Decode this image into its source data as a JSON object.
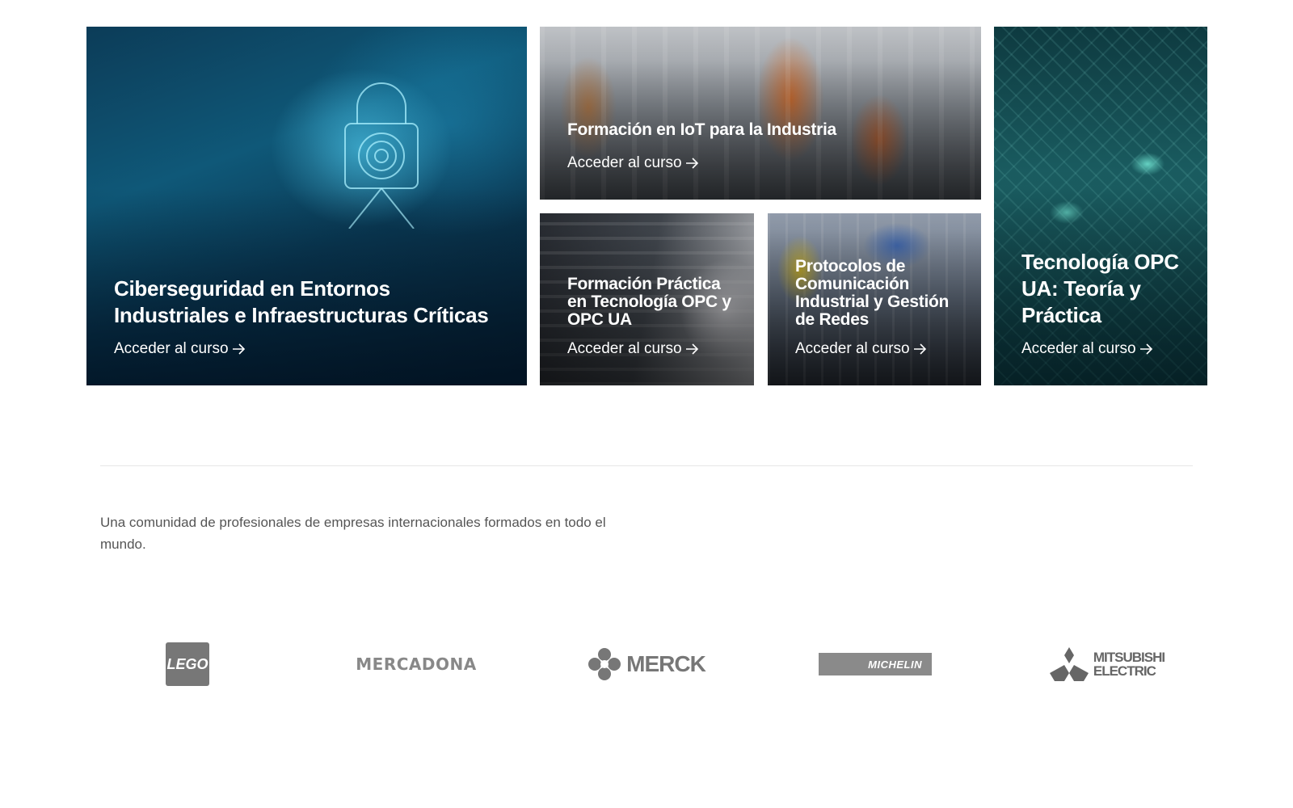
{
  "courses": [
    {
      "title": "Ciberseguridad en Entornos Industriales e Infraestructuras Críticas",
      "cta": "Acceder al curso"
    },
    {
      "title": "Formación en IoT para la Industria",
      "cta": "Acceder al curso"
    },
    {
      "title": "Formación Práctica en Tecnología OPC y OPC UA",
      "cta": "Acceder al curso"
    },
    {
      "title": "Protocolos de Comunicación Industrial y Gestión de Redes",
      "cta": "Acceder al curso"
    },
    {
      "title": "Tecnología OPC UA: Teoría y Práctica",
      "cta": "Acceder al curso"
    }
  ],
  "community": {
    "tagline": "Una comunidad de profesionales de empresas internacionales formados en todo el mundo."
  },
  "logos": {
    "lego": "LEGO",
    "mercadona": "MERCADONA",
    "merck": "MERCK",
    "michelin": "MICHELIN",
    "mitsubishi_line1": "MITSUBISHI",
    "mitsubishi_line2": "ELECTRIC"
  },
  "colors": {
    "card_text": "#ffffff",
    "tagline": "#555555",
    "logo_gray": "#777777"
  }
}
